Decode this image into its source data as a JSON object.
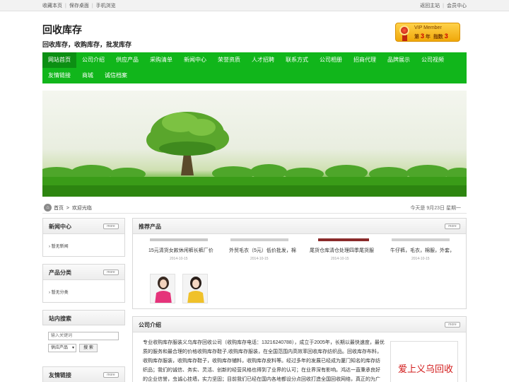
{
  "topbar": {
    "left_links": [
      "收藏本页",
      "保存桌面",
      "手机浏览"
    ],
    "right_links": [
      "返回主站",
      "会员中心"
    ]
  },
  "brand": {
    "title": "回收库存",
    "subtitle": "回收库存，收购库存，批发库存"
  },
  "vip": {
    "label": "VIP Member",
    "level_prefix": "第",
    "level": "3",
    "level_suffix": "年",
    "index_label": "指数",
    "index_value": "3"
  },
  "nav": {
    "items": [
      "网站首页",
      "公司介绍",
      "供应产品",
      "采购清单",
      "新闻中心",
      "荣誉资质",
      "人才招聘",
      "联系方式",
      "公司相册",
      "招商代理",
      "品牌展示",
      "公司视频",
      "友情链接",
      "商城",
      "诚信档案"
    ],
    "active_index": 0
  },
  "breadcrumb": {
    "home": "首页",
    "separator": ">",
    "current": "欢迎光临",
    "date": "今天是 9月23日 星期一"
  },
  "sidebar": {
    "news": {
      "title": "新闻中心",
      "more": "more",
      "items": [
        "暂无新闻"
      ]
    },
    "category": {
      "title": "产品分类",
      "more": "more",
      "items": [
        "暂无分类"
      ]
    },
    "search": {
      "title": "站内搜索",
      "placeholder": "输入关键词",
      "select_value": "供应产品",
      "button": "搜 索"
    },
    "links": {
      "title": "友情链接",
      "more": "more"
    }
  },
  "products": {
    "title": "推荐产品",
    "more": "more",
    "items": [
      {
        "name": "15元清货女款休闲裤长裤厂价",
        "date": "2014-10-15"
      },
      {
        "name": "外贸毛衣（5元）低价批发，棉",
        "date": "2014-10-15"
      },
      {
        "name": "尾货仓库清仓处理四季尾货服",
        "date": "2014-10-15"
      },
      {
        "name": "牛仔裤，毛衣，棉服，外套，",
        "date": "2014-10-15"
      }
    ]
  },
  "about": {
    "title": "公司介绍",
    "more": "more",
    "text": "专业收购库存服装义乌库存回收公司（收购库存电话：13216240788），成立于2005年，长期以最快速度，最优质的服务和最合理的价格收购库存鞋子,收购库存服装，在全国范围内高效率回收库存纺织品。回收库存布料，收购库存服装，收购库存鞋子，收购库存辅料，收购库存皮料等。经过多年的发展已经成为厦门知名的库存纺织品；我们的诚信、务实、灵活、创新的经营风格也得到了业界的认可；在业界深有影响。鸿达一直秉承良好的企业信誉，虫诚心挂墙，实力坚固；目前我们已经在国内各地都设分点回收打造全国回收网络，真正的为广",
    "image_caption": "爱上义乌回收"
  }
}
